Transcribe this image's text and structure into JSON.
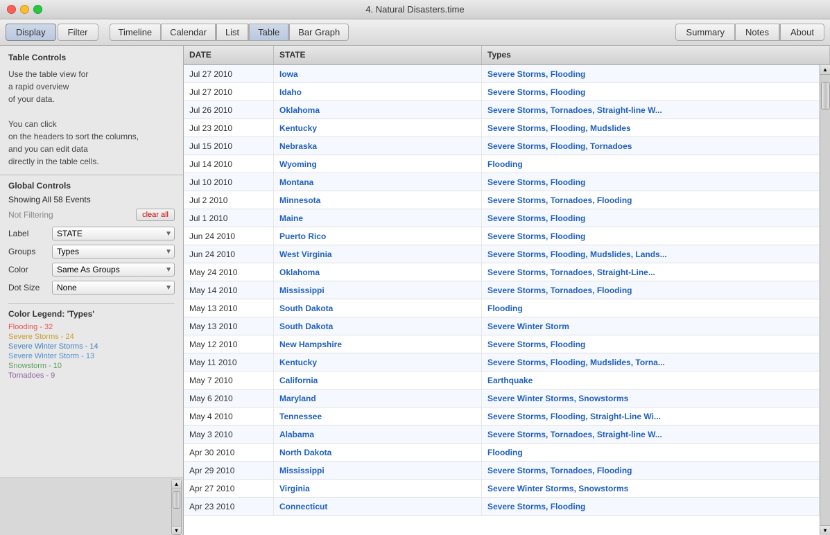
{
  "window": {
    "title": "4. Natural Disasters.time"
  },
  "toolbar": {
    "display_label": "Display",
    "filter_label": "Filter",
    "timeline_label": "Timeline",
    "calendar_label": "Calendar",
    "list_label": "List",
    "table_label": "Table",
    "bar_graph_label": "Bar Graph",
    "summary_label": "Summary",
    "notes_label": "Notes",
    "about_label": "About"
  },
  "sidebar": {
    "table_controls_title": "Table Controls",
    "help_line1": "Use the table view for",
    "help_line2": "a rapid overview",
    "help_line3": "of your data.",
    "help_line4": "",
    "help_line5": "You can click",
    "help_line6": "on the headers to sort the columns,",
    "help_line7": "and you can edit data",
    "help_line8": "directly in the table cells.",
    "global_controls_title": "Global Controls",
    "showing_events": "Showing All 58 Events",
    "not_filtering": "Not Filtering",
    "clear_all_label": "clear all",
    "label_label": "Label",
    "label_value": "STATE",
    "groups_label": "Groups",
    "groups_value": "Types",
    "color_label": "Color",
    "color_value": "Same As Groups",
    "dot_size_label": "Dot Size",
    "dot_size_value": "None",
    "legend_title": "Color Legend: 'Types'",
    "legend_items": [
      {
        "label": "Flooding - 32",
        "color": "#e05050"
      },
      {
        "label": "Severe Storms - 24",
        "color": "#c8a030"
      },
      {
        "label": "Severe Winter Storms - 14",
        "color": "#4080c0"
      },
      {
        "label": "Severe Winter Storm - 13",
        "color": "#5090d0"
      },
      {
        "label": "Snowstorm - 10",
        "color": "#50a050"
      },
      {
        "label": "Tornadoes - 9",
        "color": "#9060a0"
      }
    ]
  },
  "table": {
    "headers": [
      "DATE",
      "STATE",
      "Types"
    ],
    "rows": [
      {
        "date": "Jul 27 2010",
        "state": "Iowa",
        "types": "Severe Storms, Flooding"
      },
      {
        "date": "Jul 27 2010",
        "state": "Idaho",
        "types": "Severe Storms, Flooding"
      },
      {
        "date": "Jul 26 2010",
        "state": "Oklahoma",
        "types": "Severe Storms, Tornadoes, Straight-line W..."
      },
      {
        "date": "Jul 23 2010",
        "state": "Kentucky",
        "types": "Severe Storms, Flooding, Mudslides"
      },
      {
        "date": "Jul 15 2010",
        "state": "Nebraska",
        "types": "Severe Storms, Flooding, Tornadoes"
      },
      {
        "date": "Jul 14 2010",
        "state": "Wyoming",
        "types": "Flooding"
      },
      {
        "date": "Jul 10 2010",
        "state": "Montana",
        "types": "Severe Storms, Flooding"
      },
      {
        "date": "Jul 2 2010",
        "state": "Minnesota",
        "types": "Severe Storms, Tornadoes, Flooding"
      },
      {
        "date": "Jul 1 2010",
        "state": "Maine",
        "types": "Severe Storms, Flooding"
      },
      {
        "date": "Jun 24 2010",
        "state": "Puerto Rico",
        "types": "Severe Storms, Flooding"
      },
      {
        "date": "Jun 24 2010",
        "state": "West Virginia",
        "types": "Severe Storms, Flooding, Mudslides, Lands..."
      },
      {
        "date": "May 24 2010",
        "state": "Oklahoma",
        "types": "Severe Storms, Tornadoes, Straight-Line..."
      },
      {
        "date": "May 14 2010",
        "state": "Mississippi",
        "types": "Severe Storms, Tornadoes, Flooding"
      },
      {
        "date": "May 13 2010",
        "state": "South Dakota",
        "types": "Flooding"
      },
      {
        "date": "May 13 2010",
        "state": "South Dakota",
        "types": "Severe Winter Storm"
      },
      {
        "date": "May 12 2010",
        "state": "New Hampshire",
        "types": "Severe Storms, Flooding"
      },
      {
        "date": "May 11 2010",
        "state": "Kentucky",
        "types": "Severe Storms, Flooding, Mudslides, Torna..."
      },
      {
        "date": "May 7 2010",
        "state": "California",
        "types": "Earthquake"
      },
      {
        "date": "May 6 2010",
        "state": "Maryland",
        "types": "Severe Winter Storms, Snowstorms"
      },
      {
        "date": "May 4 2010",
        "state": "Tennessee",
        "types": "Severe Storms, Flooding, Straight-Line Wi..."
      },
      {
        "date": "May 3 2010",
        "state": "Alabama",
        "types": "Severe Storms, Tornadoes, Straight-line W..."
      },
      {
        "date": "Apr 30 2010",
        "state": "North Dakota",
        "types": "Flooding"
      },
      {
        "date": "Apr 29 2010",
        "state": "Mississippi",
        "types": "Severe Storms, Tornadoes, Flooding"
      },
      {
        "date": "Apr 27 2010",
        "state": "Virginia",
        "types": "Severe Winter Storms, Snowstorms"
      },
      {
        "date": "Apr 23 2010",
        "state": "Connecticut",
        "types": "Severe Storms, Flooding"
      }
    ]
  }
}
